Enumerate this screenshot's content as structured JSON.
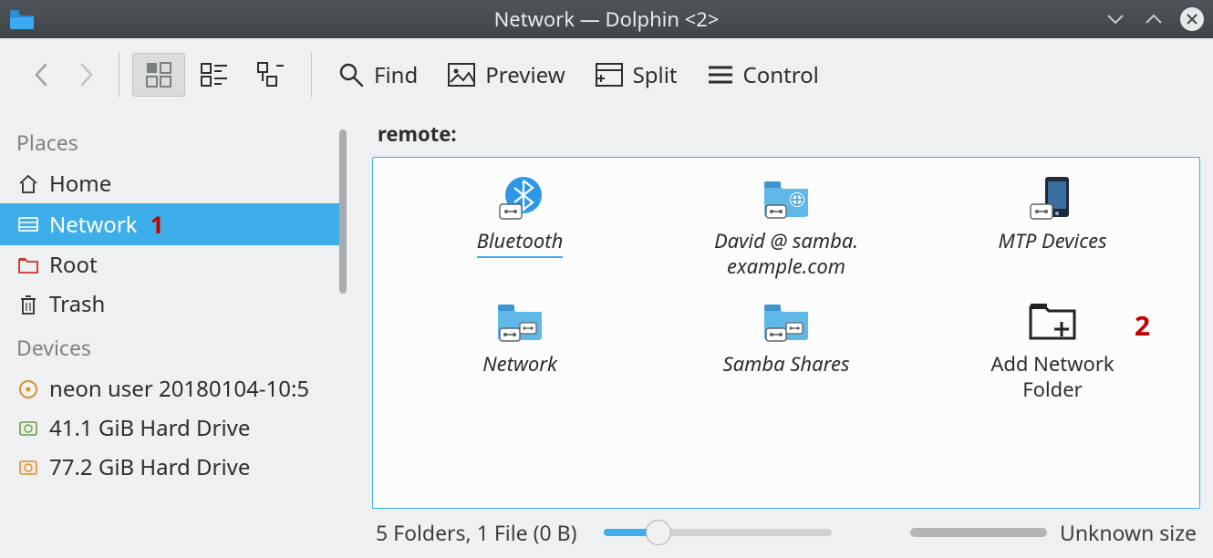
{
  "window": {
    "title": "Network — Dolphin <2>"
  },
  "toolbar": {
    "find": "Find",
    "preview": "Preview",
    "split": "Split",
    "control": "Control"
  },
  "sidebar": {
    "places_title": "Places",
    "devices_title": "Devices",
    "places": [
      {
        "label": "Home"
      },
      {
        "label": "Network"
      },
      {
        "label": "Root"
      },
      {
        "label": "Trash"
      }
    ],
    "devices": [
      {
        "label": "neon user 20180104-10:5"
      },
      {
        "label": "41.1 GiB Hard Drive"
      },
      {
        "label": "77.2 GiB Hard Drive"
      }
    ]
  },
  "breadcrumb": "remote:",
  "items": [
    {
      "label": "Bluetooth"
    },
    {
      "label_line1": "David @ samba.",
      "label_line2": "example.com"
    },
    {
      "label": "MTP Devices"
    },
    {
      "label": "Network"
    },
    {
      "label": "Samba Shares"
    },
    {
      "label_line1": "Add Network",
      "label_line2": "Folder"
    }
  ],
  "annotations": {
    "sidebar_network": "1",
    "add_network_folder": "2"
  },
  "status": {
    "summary": "5 Folders, 1 File (0 B)",
    "space": "Unknown size"
  }
}
